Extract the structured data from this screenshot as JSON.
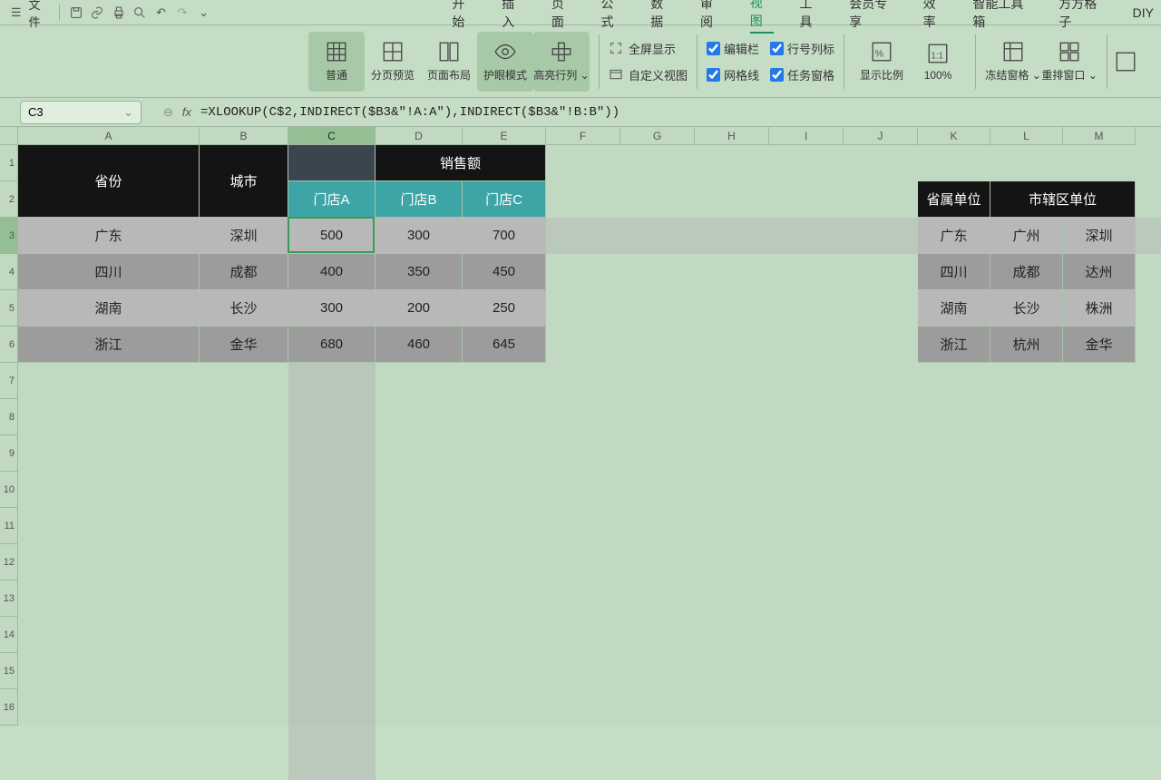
{
  "topbar": {
    "file_label": "文件"
  },
  "menubar": {
    "items": [
      "开始",
      "插入",
      "页面",
      "公式",
      "数据",
      "审阅",
      "视图",
      "工具",
      "会员专享",
      "效率",
      "智能工具箱",
      "方方格子",
      "DIY"
    ],
    "active_index": 6
  },
  "ribbon": {
    "view_buttons": [
      {
        "label": "普通",
        "icon": "grid"
      },
      {
        "label": "分页预览",
        "icon": "pagebreak"
      },
      {
        "label": "页面布局",
        "icon": "pagelayout"
      },
      {
        "label": "护眼模式",
        "icon": "eye"
      },
      {
        "label": "高亮行列",
        "icon": "highlight",
        "dropdown": true
      }
    ],
    "selected_indices": [
      0,
      3,
      4
    ],
    "fullscreen_label": "全屏显示",
    "customview_label": "自定义视图",
    "checks": {
      "editbar": {
        "label": "编辑栏",
        "checked": true
      },
      "rowcolhdr": {
        "label": "行号列标",
        "checked": true
      },
      "gridlines": {
        "label": "网格线",
        "checked": true
      },
      "taskpane": {
        "label": "任务窗格",
        "checked": true
      }
    },
    "zoom_label": "显示比例",
    "zoom_value": "100%",
    "freeze_label": "冻结窗格",
    "rearrange_label": "重排窗口"
  },
  "formula_bar": {
    "cell_ref": "C3",
    "formula": "=XLOOKUP(C$2,INDIRECT($B3&\"!A:A\"),INDIRECT($B3&\"!B:B\"))"
  },
  "columns": [
    "A",
    "B",
    "C",
    "D",
    "E",
    "F",
    "G",
    "H",
    "I",
    "J",
    "K",
    "L",
    "M"
  ],
  "col_widths": {
    "A": 200,
    "B": 98,
    "C": 96,
    "D": 96,
    "E": 92,
    "F": 82,
    "G": 82,
    "H": 82,
    "I": 82,
    "J": 82,
    "K": 80,
    "L": 80,
    "M": 80
  },
  "row_heights": {
    "1": 40,
    "2": 40,
    "3": 40,
    "4": 40,
    "5": 40,
    "6": 40,
    "default": 40
  },
  "num_display_rows": 16,
  "selected_col": "C",
  "selected_row": 3,
  "table1": {
    "header_province": "省份",
    "header_city": "城市",
    "header_sales": "销售额",
    "stores": [
      "门店A",
      "门店B",
      "门店C"
    ],
    "rows": [
      {
        "province": "广东",
        "city": "深圳",
        "v": [
          500,
          300,
          700
        ]
      },
      {
        "province": "四川",
        "city": "成都",
        "v": [
          400,
          350,
          450
        ]
      },
      {
        "province": "湖南",
        "city": "长沙",
        "v": [
          300,
          200,
          250
        ]
      },
      {
        "province": "浙江",
        "city": "金华",
        "v": [
          680,
          460,
          645
        ]
      }
    ]
  },
  "table2": {
    "header_prov": "省属单位",
    "header_city": "市辖区单位",
    "rows": [
      {
        "k": "广东",
        "c1": "广州",
        "c2": "深圳"
      },
      {
        "k": "四川",
        "c1": "成都",
        "c2": "达州"
      },
      {
        "k": "湖南",
        "c1": "长沙",
        "c2": "株洲"
      },
      {
        "k": "浙江",
        "c1": "杭州",
        "c2": "金华"
      }
    ]
  }
}
